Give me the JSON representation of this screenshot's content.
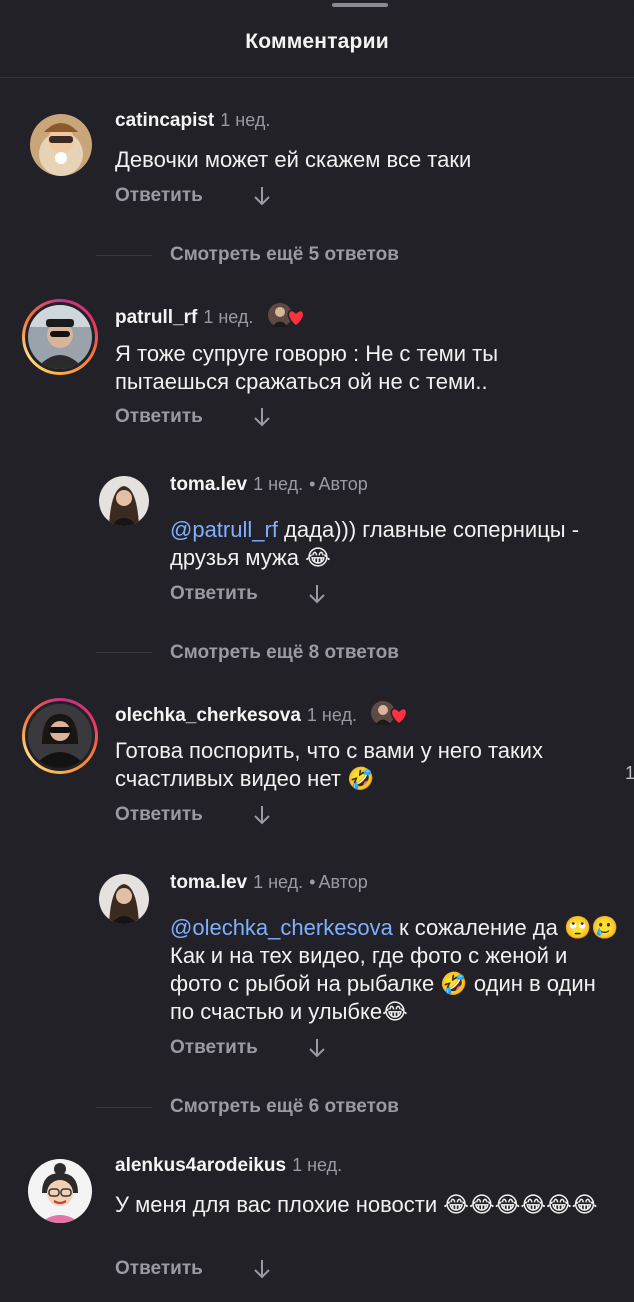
{
  "header": {
    "title": "Комментарии"
  },
  "labels": {
    "reply": "Ответить",
    "author": "Автор"
  },
  "comments": [
    {
      "username": "catincapist",
      "time": "1 нед.",
      "text": "Девочки может ей скажем все таки"
    },
    {
      "username": "patrull_rf",
      "time": "1 нед.",
      "text": "Я тоже супруге говорю : Не с теми ты пытаешься сражаться ой не с теми.."
    },
    {
      "username": "toma.lev",
      "time": "1 нед.",
      "mention": "@patrull_rf",
      "text": " дада))) главные соперницы - друзья мужа 😂"
    },
    {
      "username": "olechka_cherkesova",
      "time": "1 нед.",
      "text": "Готова поспорить, что с вами у него таких счастливых видео нет 🤣"
    },
    {
      "username": "toma.lev",
      "time": "1 нед.",
      "mention": "@olechka_cherkesova",
      "text": " к сожаление да 🙄🥲 Как и на тех видео, где фото с женой и фото с рыбой на рыбалке 🤣 один в один по счастью и улыбке😂"
    },
    {
      "username": "alenkus4arodeikus",
      "time": "1 нед.",
      "text": "У меня для вас плохие новости 😂😂😂😂😂😂"
    }
  ],
  "view_more": [
    "Смотреть ещё 5 ответов",
    "Смотреть ещё 8 ответов",
    "Смотреть ещё 6 ответов"
  ],
  "edge_text": "1",
  "colors": {
    "background": "#212127",
    "mention": "#7fb0ff",
    "secondary": "#9a9aa2",
    "like_heart": "#ff3040"
  }
}
